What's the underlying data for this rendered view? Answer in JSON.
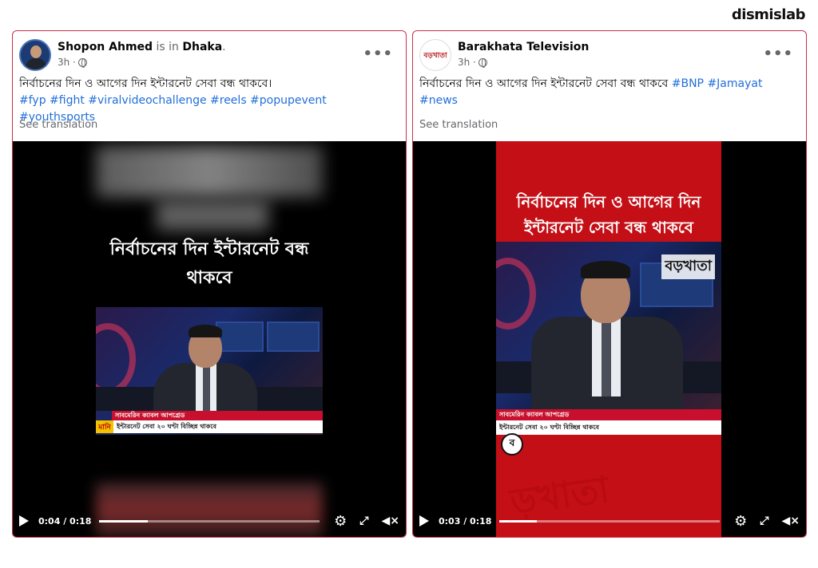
{
  "brand": "dismislab",
  "posts": [
    {
      "author": "Shopon Ahmed",
      "is_in": "is in",
      "location": "Dhaka",
      "location_suffix": ".",
      "time": "3h ·",
      "caption_text": "নির্বাচনের দিন ও আগের দিন ইন্টারনেট সেবা বন্ধ থাকবে।",
      "hashtags": "#fyp #fight #viralvideochallenge #reels #popupevent #youthsports",
      "see_translation": "See translation",
      "video_headline": "নির্বাচনের দিন ইন্টারনেট বন্ধ থাকবে",
      "ticker_top": "সাবমেরিন ক্যাবল আপগ্রেড",
      "ticker_bottom": "ইন্টারনেট সেবা ২০ ঘণ্টা বিচ্ছিন্ন থাকবে",
      "ticker_tag": "মানি",
      "time_display": "0:04 / 0:18",
      "progress": 0.22
    },
    {
      "author": "Barakhata Television",
      "avatar_text": "বড়খাতা",
      "time": "3h ·",
      "caption_text": "নির্বাচনের দিন ও আগের দিন ইন্টারনেট সেবা বন্ধ থাকবে",
      "hashtags_inline": "#BNP #Jamayat",
      "hashtags_second": "#news",
      "see_translation": "See translation",
      "video_headline": "নির্বাচনের দিন ও আগের দিন ইন্টারনেট সেবা বন্ধ থাকবে",
      "channel_logo": "বড়খাতা",
      "ticker_top": "সাবমেরিন ক্যাবল আপগ্রেড",
      "ticker_bottom": "ইন্টারনেট সেবা ২০ ঘণ্টা বিচ্ছিন্ন থাকবে",
      "round_logo": "ব",
      "watermark": "ড়খাতা",
      "time_display": "0:03 / 0:18",
      "progress": 0.17
    }
  ],
  "icons": {
    "more": "more-options-icon",
    "globe": "globe-icon",
    "play": "play-icon",
    "settings": "gear-icon",
    "fullscreen": "expand-icon",
    "volume": "volume-muted-icon"
  },
  "colors": {
    "card_border": "#c9304a",
    "hashtag": "#216fdb",
    "news_red": "#c8102e"
  }
}
